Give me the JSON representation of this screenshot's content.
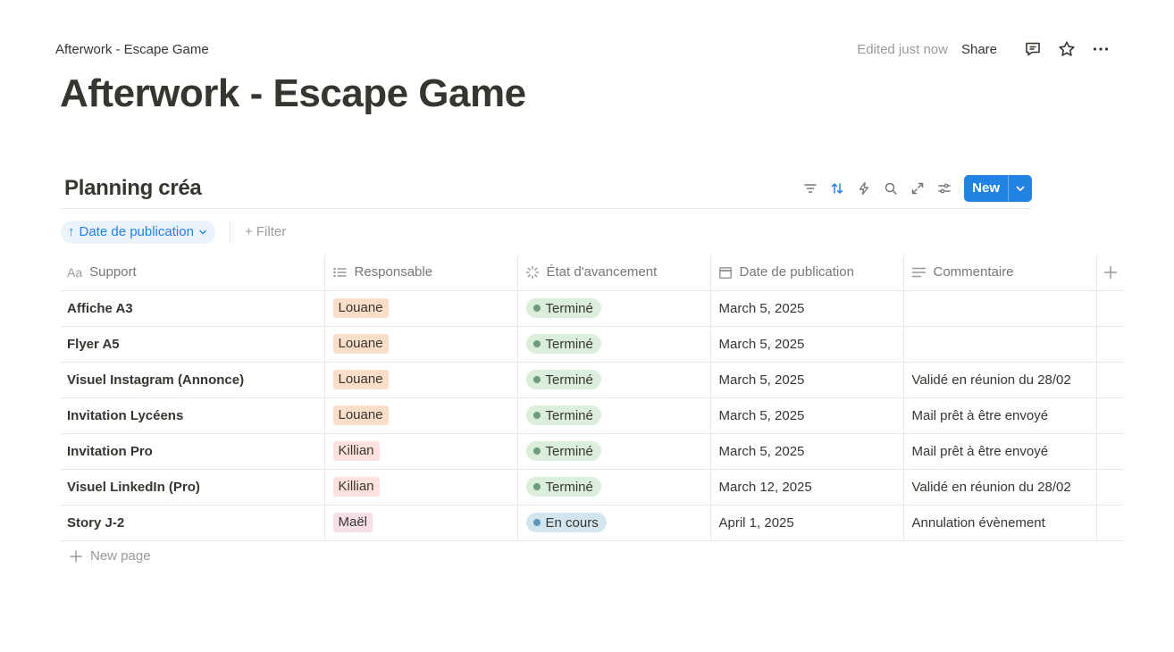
{
  "topbar": {
    "breadcrumb": "Afterwork - Escape Game",
    "edited": "Edited just now",
    "share_label": "Share",
    "icons": [
      "comment-icon",
      "star-icon",
      "more-icon"
    ]
  },
  "page": {
    "title": "Afterwork - Escape Game"
  },
  "database": {
    "title": "Planning créa",
    "toolbar_icons": [
      "filter-icon",
      "sort-icon",
      "automation-icon",
      "search-icon",
      "expand-icon",
      "settings-icon"
    ],
    "new_label": "New",
    "sort_chip": {
      "arrow": "↑",
      "label": "Date de publication"
    },
    "filter_label": "+ Filter",
    "columns": [
      {
        "label": "Support",
        "icon": "Aa"
      },
      {
        "label": "Responsable",
        "icon": "list-icon"
      },
      {
        "label": "État d'avancement",
        "icon": "status-icon"
      },
      {
        "label": "Date de publication",
        "icon": "calendar-icon"
      },
      {
        "label": "Commentaire",
        "icon": "text-icon"
      }
    ],
    "rows": [
      {
        "support": "Affiche A3",
        "responsable": "Louane",
        "etat": "Terminé",
        "date": "March 5, 2025",
        "commentaire": ""
      },
      {
        "support": "Flyer A5",
        "responsable": "Louane",
        "etat": "Terminé",
        "date": "March 5, 2025",
        "commentaire": ""
      },
      {
        "support": "Visuel Instagram (Annonce)",
        "responsable": "Louane",
        "etat": "Terminé",
        "date": "March 5, 2025",
        "commentaire": "Validé en réunion du 28/02"
      },
      {
        "support": "Invitation Lycéens",
        "responsable": "Louane",
        "etat": "Terminé",
        "date": "March 5, 2025",
        "commentaire": "Mail prêt à être envoyé"
      },
      {
        "support": "Invitation Pro",
        "responsable": "Killian",
        "etat": "Terminé",
        "date": "March 5, 2025",
        "commentaire": "Mail prêt à être envoyé"
      },
      {
        "support": "Visuel LinkedIn (Pro)",
        "responsable": "Killian",
        "etat": "Terminé",
        "date": "March 12, 2025",
        "commentaire": "Validé en réunion du 28/02"
      },
      {
        "support": "Story J-2",
        "responsable": "Maël",
        "etat": "En cours",
        "date": "April 1, 2025",
        "commentaire": "Annulation évènement"
      }
    ],
    "new_page_label": "New page"
  },
  "colors": {
    "accent": "#2383e2",
    "tag_louane": "#fadec9",
    "tag_killian": "#ffe2dd",
    "tag_mael": "#f5e0e9",
    "status_done_bg": "#dbeddb",
    "status_done_dot": "#6c9b7d",
    "status_progress_bg": "#d3e5ef",
    "status_progress_dot": "#5b97bd"
  }
}
